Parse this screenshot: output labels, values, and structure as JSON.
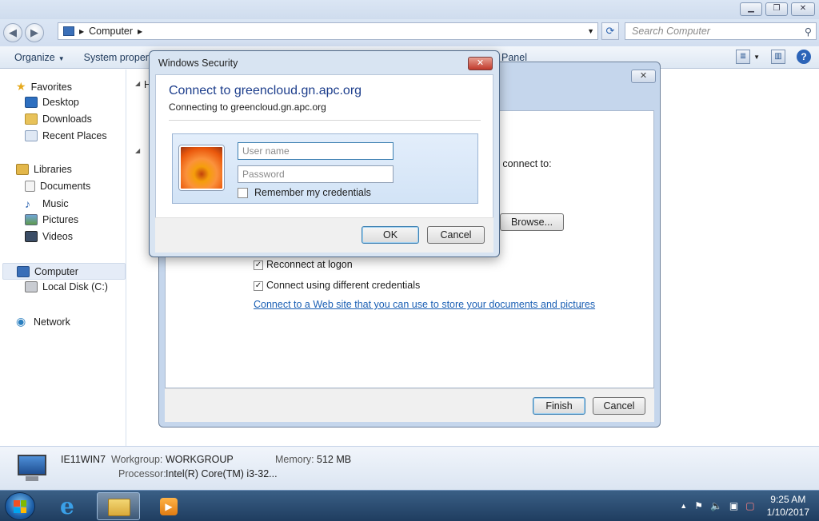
{
  "explorer": {
    "breadcrumb": "Computer",
    "search_placeholder": "Search Computer",
    "commands": {
      "organize": "Organize",
      "system_properties": "System proper",
      "control_panel": "Panel"
    },
    "nav": {
      "favorites": "Favorites",
      "desktop": "Desktop",
      "downloads": "Downloads",
      "recent_places": "Recent Places",
      "libraries": "Libraries",
      "documents": "Documents",
      "music": "Music",
      "pictures": "Pictures",
      "videos": "Videos",
      "computer": "Computer",
      "local_disk": "Local Disk (C:)",
      "network": "Network"
    },
    "content_heading_fragment": "H",
    "details": {
      "name": "IE11WIN7",
      "workgroup_label": "Workgroup:",
      "workgroup": "WORKGROUP",
      "memory_label": "Memory:",
      "memory": "512 MB",
      "processor_label": "Processor:",
      "processor": "Intel(R) Core(TM) i3-32..."
    }
  },
  "wizard": {
    "connect_to_fragment": "o connect to:",
    "browse_label": "Browse...",
    "reconnect_label": "Reconnect at logon",
    "reconnect_checked": true,
    "different_credentials_label": "Connect using different credentials",
    "different_credentials_checked": true,
    "web_link": "Connect to a Web site that you can use to store your documents and pictures",
    "link_period": ".",
    "finish_label": "Finish",
    "cancel_label": "Cancel"
  },
  "security_dialog": {
    "title": "Windows Security",
    "heading": "Connect to greencloud.gn.apc.org",
    "subheading": "Connecting to greencloud.gn.apc.org",
    "username_placeholder": "User name",
    "password_placeholder": "Password",
    "remember_label": "Remember my credentials",
    "remember_checked": false,
    "ok_label": "OK",
    "cancel_label": "Cancel"
  },
  "taskbar": {
    "time": "9:25 AM",
    "date": "1/10/2017"
  },
  "colors": {
    "link": "#1a5fb4",
    "heading": "#1d3e8c",
    "taskbar": "#2a4a70"
  }
}
